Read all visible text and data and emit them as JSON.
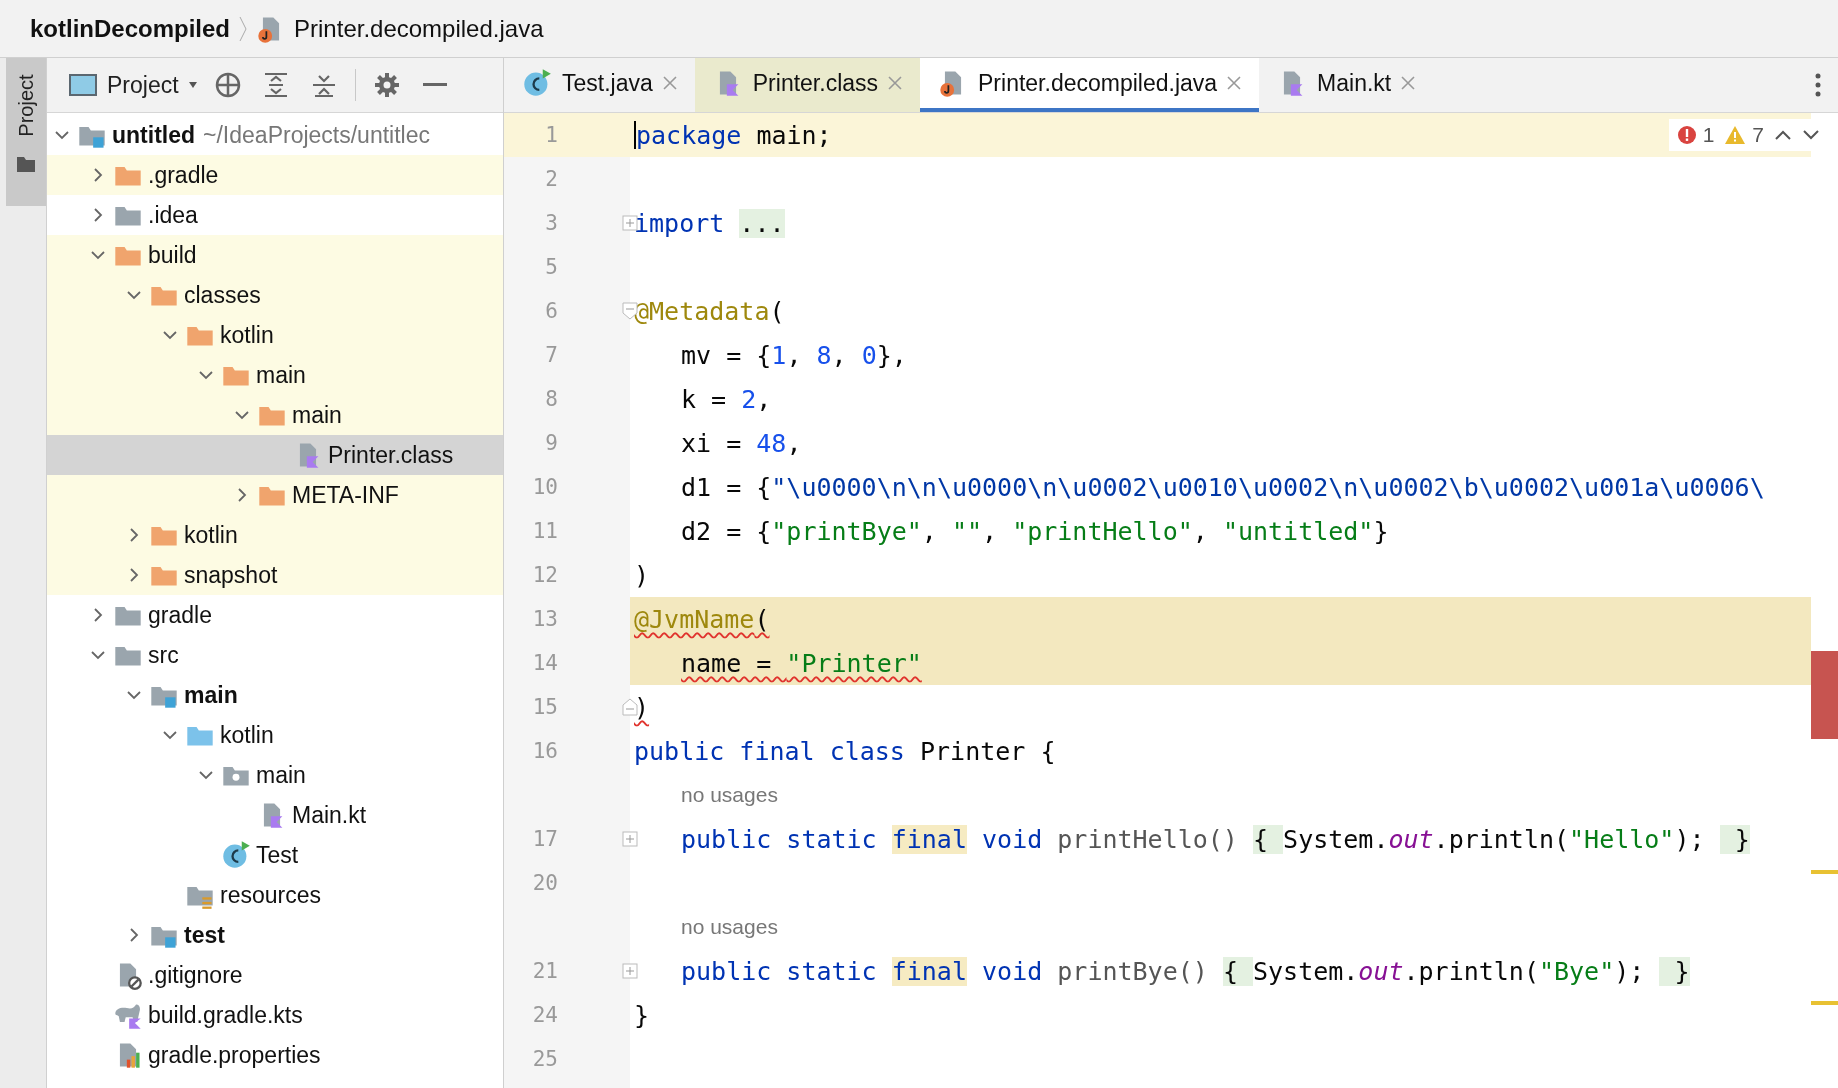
{
  "breadcrumb": {
    "project": "kotlinDecompiled",
    "file": "Printer.decompiled.java"
  },
  "tool_strip": {
    "label": "Project",
    "selected": true
  },
  "project_panel": {
    "title": "Project",
    "tree": [
      {
        "label": "untitled",
        "hint": "~/IdeaProjects/untitlec",
        "kind": "module",
        "bold": true,
        "expanded": true,
        "highlighted": false,
        "selected": false,
        "children": [
          {
            "label": ".gradle",
            "kind": "excluded",
            "expanded": false,
            "highlighted": true,
            "selected": false
          },
          {
            "label": ".idea",
            "kind": "folder",
            "expanded": false,
            "highlighted": false,
            "selected": false
          },
          {
            "label": "build",
            "kind": "excluded",
            "expanded": true,
            "highlighted": true,
            "selected": false,
            "children": [
              {
                "label": "classes",
                "kind": "excluded",
                "expanded": true,
                "highlighted": true,
                "selected": false,
                "children": [
                  {
                    "label": "kotlin",
                    "kind": "excluded",
                    "expanded": true,
                    "highlighted": true,
                    "selected": false,
                    "children": [
                      {
                        "label": "main",
                        "kind": "excluded",
                        "expanded": true,
                        "highlighted": true,
                        "selected": false,
                        "children": [
                          {
                            "label": "main",
                            "kind": "excluded",
                            "expanded": true,
                            "highlighted": true,
                            "selected": false,
                            "children": [
                              {
                                "label": "Printer.class",
                                "kind": "bytecode",
                                "highlighted": false,
                                "selected": true
                              }
                            ]
                          },
                          {
                            "label": "META-INF",
                            "kind": "excluded",
                            "expanded": false,
                            "highlighted": true,
                            "selected": false
                          }
                        ]
                      }
                    ]
                  }
                ]
              },
              {
                "label": "kotlin",
                "kind": "excluded",
                "expanded": false,
                "highlighted": true,
                "selected": false
              },
              {
                "label": "snapshot",
                "kind": "excluded",
                "expanded": false,
                "highlighted": true,
                "selected": false
              }
            ]
          },
          {
            "label": "gradle",
            "kind": "folder",
            "expanded": false,
            "highlighted": false,
            "selected": false
          },
          {
            "label": "src",
            "kind": "folder",
            "expanded": true,
            "highlighted": false,
            "selected": false,
            "children": [
              {
                "label": "main",
                "kind": "module",
                "bold": true,
                "expanded": true,
                "highlighted": false,
                "selected": false,
                "children": [
                  {
                    "label": "kotlin",
                    "kind": "sources",
                    "expanded": true,
                    "highlighted": false,
                    "selected": false,
                    "children": [
                      {
                        "label": "main",
                        "kind": "package",
                        "expanded": true,
                        "highlighted": false,
                        "selected": false,
                        "children": [
                          {
                            "label": "Main.kt",
                            "kind": "kotlin",
                            "highlighted": false,
                            "selected": false
                          }
                        ]
                      },
                      {
                        "label": "Test",
                        "kind": "class",
                        "highlighted": false,
                        "selected": false
                      }
                    ]
                  },
                  {
                    "label": "resources",
                    "kind": "resources",
                    "highlighted": false,
                    "selected": false
                  }
                ]
              },
              {
                "label": "test",
                "kind": "module",
                "bold": true,
                "expanded": false,
                "highlighted": false,
                "selected": false
              }
            ]
          },
          {
            "label": ".gitignore",
            "kind": "ignore",
            "highlighted": false,
            "selected": false
          },
          {
            "label": "build.gradle.kts",
            "kind": "gradle",
            "highlighted": false,
            "selected": false
          },
          {
            "label": "gradle.properties",
            "kind": "properties",
            "highlighted": false,
            "selected": false
          }
        ]
      }
    ]
  },
  "editor": {
    "tabs": [
      {
        "label": "Test.java",
        "kind": "class",
        "selected": false,
        "tinted": false
      },
      {
        "label": "Printer.class",
        "kind": "bytecode",
        "selected": false,
        "tinted": true
      },
      {
        "label": "Printer.decompiled.java",
        "kind": "java",
        "selected": true,
        "tinted": false
      },
      {
        "label": "Main.kt",
        "kind": "kotlin",
        "selected": false,
        "tinted": false
      }
    ],
    "inspections": {
      "errors": "1",
      "warnings": "7"
    },
    "lines": [
      {
        "kind": "code",
        "number": "1",
        "current": true,
        "band": false,
        "indented": false,
        "error": false,
        "tokens": [
          {
            "text": "package",
            "kind": "keyword"
          },
          {
            "text": " main;",
            "kind": "plain"
          }
        ]
      },
      {
        "kind": "blank",
        "number": "2"
      },
      {
        "kind": "code",
        "number": "3",
        "current": false,
        "band": false,
        "indented": false,
        "error": false,
        "folded": true,
        "tokens": [
          {
            "text": "import ",
            "kind": "keyword"
          },
          {
            "text": "...",
            "kind": "plain",
            "fold": true
          }
        ]
      },
      {
        "kind": "blank",
        "number": "5"
      },
      {
        "kind": "code",
        "number": "6",
        "current": false,
        "band": false,
        "indented": false,
        "error": false,
        "fold_open": true,
        "tokens": [
          {
            "text": "@Metadata",
            "kind": "annotation"
          },
          {
            "text": "(",
            "kind": "plain"
          }
        ]
      },
      {
        "kind": "code",
        "number": "7",
        "current": false,
        "band": false,
        "indented": true,
        "error": false,
        "tokens": [
          {
            "text": "mv = {",
            "kind": "plain"
          },
          {
            "text": "1",
            "kind": "number"
          },
          {
            "text": ", ",
            "kind": "plain"
          },
          {
            "text": "8",
            "kind": "number"
          },
          {
            "text": ", ",
            "kind": "plain"
          },
          {
            "text": "0",
            "kind": "number"
          },
          {
            "text": "},",
            "kind": "plain"
          }
        ]
      },
      {
        "kind": "code",
        "number": "8",
        "current": false,
        "band": false,
        "indented": true,
        "error": false,
        "tokens": [
          {
            "text": "k = ",
            "kind": "plain"
          },
          {
            "text": "2",
            "kind": "number"
          },
          {
            "text": ",",
            "kind": "plain"
          }
        ]
      },
      {
        "kind": "code",
        "number": "9",
        "current": false,
        "band": false,
        "indented": true,
        "error": false,
        "tokens": [
          {
            "text": "xi = ",
            "kind": "plain"
          },
          {
            "text": "48",
            "kind": "number"
          },
          {
            "text": ",",
            "kind": "plain"
          }
        ]
      },
      {
        "kind": "code",
        "number": "10",
        "current": false,
        "band": false,
        "indented": true,
        "error": false,
        "tokens": [
          {
            "text": "d1 = {",
            "kind": "plain"
          },
          {
            "text": "\"\\u0000\\n\\n\\u0000\\n\\u0002\\u0010\\u0002\\n\\u0002\\b\\u0002\\u001a\\u0006\\",
            "kind": "escape"
          }
        ]
      },
      {
        "kind": "code",
        "number": "11",
        "current": false,
        "band": false,
        "indented": true,
        "error": false,
        "tokens": [
          {
            "text": "d2 = {",
            "kind": "plain"
          },
          {
            "text": "\"printBye\"",
            "kind": "string"
          },
          {
            "text": ", ",
            "kind": "plain"
          },
          {
            "text": "\"\"",
            "kind": "string"
          },
          {
            "text": ", ",
            "kind": "plain"
          },
          {
            "text": "\"printHello\"",
            "kind": "string"
          },
          {
            "text": ", ",
            "kind": "plain"
          },
          {
            "text": "\"untitled\"",
            "kind": "string"
          },
          {
            "text": "}",
            "kind": "plain"
          }
        ]
      },
      {
        "kind": "code",
        "number": "12",
        "current": false,
        "band": false,
        "indented": false,
        "error": false,
        "tokens": [
          {
            "text": ")",
            "kind": "plain"
          }
        ]
      },
      {
        "kind": "code",
        "number": "13",
        "current": false,
        "band": true,
        "indented": false,
        "error": true,
        "tokens": [
          {
            "text": "@JvmName",
            "kind": "annotation"
          },
          {
            "text": "(",
            "kind": "plain"
          }
        ]
      },
      {
        "kind": "code",
        "number": "14",
        "current": false,
        "band": true,
        "indented": true,
        "error": true,
        "tokens": [
          {
            "text": "name = ",
            "kind": "plain"
          },
          {
            "text": "\"Printer\"",
            "kind": "string"
          }
        ]
      },
      {
        "kind": "code",
        "number": "15",
        "current": false,
        "band": false,
        "indented": false,
        "error": true,
        "fold_close": true,
        "tokens": [
          {
            "text": ")",
            "kind": "plain"
          }
        ]
      },
      {
        "kind": "code",
        "number": "16",
        "current": false,
        "band": false,
        "indented": false,
        "error": false,
        "tokens": [
          {
            "text": "public final class",
            "kind": "keyword"
          },
          {
            "text": " Printer {",
            "kind": "plain"
          }
        ]
      },
      {
        "kind": "inlay",
        "text": "no usages"
      },
      {
        "kind": "code",
        "number": "17",
        "current": false,
        "band": false,
        "indented": true,
        "error": false,
        "folded": true,
        "tokens": [
          {
            "text": "public static ",
            "kind": "keyword"
          },
          {
            "text": "final",
            "kind": "keyword",
            "warn": true
          },
          {
            "text": " void",
            "kind": "keyword"
          },
          {
            "text": " printHello() ",
            "kind": "unused"
          },
          {
            "text": "{ ",
            "kind": "plain",
            "fold": true
          },
          {
            "text": "System.",
            "kind": "plain"
          },
          {
            "text": "out",
            "kind": "field"
          },
          {
            "text": ".println(",
            "kind": "plain"
          },
          {
            "text": "\"Hello\"",
            "kind": "string"
          },
          {
            "text": "); ",
            "kind": "plain"
          },
          {
            "text": " }",
            "kind": "plain",
            "fold": true
          }
        ]
      },
      {
        "kind": "blank",
        "number": "20"
      },
      {
        "kind": "inlay",
        "text": "no usages"
      },
      {
        "kind": "code",
        "number": "21",
        "current": false,
        "band": false,
        "indented": true,
        "error": false,
        "folded": true,
        "tokens": [
          {
            "text": "public static ",
            "kind": "keyword"
          },
          {
            "text": "final",
            "kind": "keyword",
            "warn": true
          },
          {
            "text": " void",
            "kind": "keyword"
          },
          {
            "text": " printBye() ",
            "kind": "unused"
          },
          {
            "text": "{ ",
            "kind": "plain",
            "fold": true
          },
          {
            "text": "System.",
            "kind": "plain"
          },
          {
            "text": "out",
            "kind": "field"
          },
          {
            "text": ".println(",
            "kind": "plain"
          },
          {
            "text": "\"Bye\"",
            "kind": "string"
          },
          {
            "text": "); ",
            "kind": "plain"
          },
          {
            "text": " }",
            "kind": "plain",
            "fold": true
          }
        ]
      },
      {
        "kind": "code",
        "number": "24",
        "current": false,
        "band": false,
        "indented": false,
        "error": false,
        "tokens": [
          {
            "text": "}",
            "kind": "plain"
          }
        ]
      },
      {
        "kind": "blank",
        "number": "25"
      }
    ]
  }
}
